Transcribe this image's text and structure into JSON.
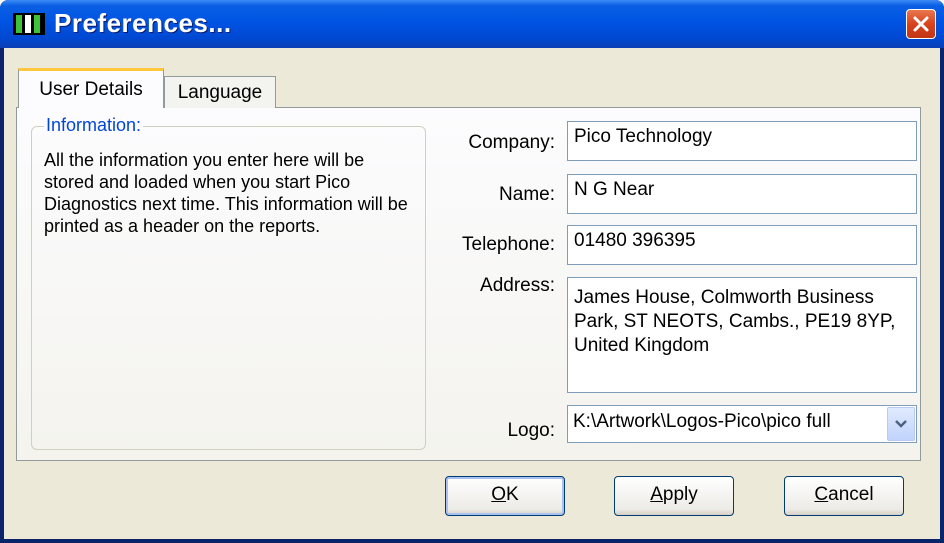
{
  "window": {
    "title": "Preferences...",
    "close_icon": "close-icon",
    "app_icon": "pico-app-icon"
  },
  "tabs": [
    {
      "label": "User Details",
      "active": true
    },
    {
      "label": "Language",
      "active": false
    }
  ],
  "info": {
    "group_label": "Information:",
    "text": "All the information you enter here will be stored and loaded when you start Pico Diagnostics next time. This information will be printed as a header on the reports."
  },
  "form": {
    "company": {
      "label": "Company:",
      "value": "Pico Technology"
    },
    "name": {
      "label": "Name:",
      "value": "N G Near"
    },
    "telephone": {
      "label": "Telephone:",
      "value": "01480 396395"
    },
    "address": {
      "label": "Address:",
      "value": "James House, Colmworth Business Park, ST NEOTS, Cambs., PE19 8YP, United Kingdom"
    },
    "logo": {
      "label": "Logo:",
      "value": "K:\\Artwork\\Logos-Pico\\pico full",
      "dropdown_icon": "chevron-down-icon"
    }
  },
  "buttons": {
    "ok": {
      "mnemonic": "O",
      "rest": "K"
    },
    "apply": {
      "mnemonic": "A",
      "rest": "pply"
    },
    "cancel": {
      "mnemonic": "C",
      "rest": "ancel"
    }
  },
  "colors": {
    "titlebar": "#0054e3",
    "tab_highlight": "#ffc83c",
    "group_label": "#0046d5",
    "close_button": "#d9431c"
  }
}
